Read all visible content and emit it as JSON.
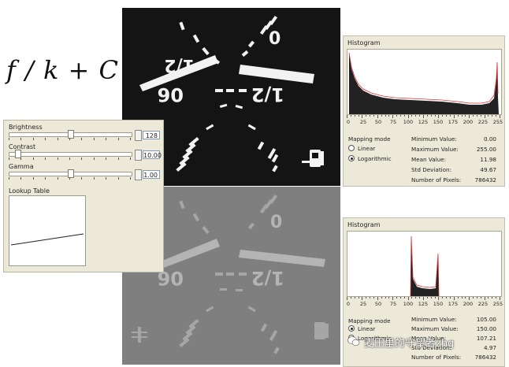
{
  "formula": "f / k + C",
  "controls": {
    "brightness": {
      "label": "Brightness",
      "value": "128",
      "level": 0.5
    },
    "contrast": {
      "label": "Contrast",
      "value": "10.00",
      "level": 0.05
    },
    "gamma": {
      "label": "Gamma",
      "value": "1.00",
      "level": 0.5
    },
    "lut_label": "Lookup Table"
  },
  "histograms": [
    {
      "title": "Histogram",
      "axis_labels": [
        "0",
        "25",
        "50",
        "75",
        "100",
        "125",
        "150",
        "175",
        "200",
        "225",
        "255"
      ],
      "mapping_mode_label": "Mapping mode",
      "linear_label": "Linear",
      "log_label": "Logarithmic",
      "selected_mode": "Logarithmic",
      "stats": [
        {
          "name": "Minimum Value:",
          "value": "0.00"
        },
        {
          "name": "Maximum Value:",
          "value": "255.00"
        },
        {
          "name": "Mean Value:",
          "value": "11.98"
        },
        {
          "name": "Std Deviation:",
          "value": "49.67"
        },
        {
          "name": "Number of Pixels:",
          "value": "786432"
        }
      ]
    },
    {
      "title": "Histogram",
      "axis_labels": [
        "0",
        "25",
        "50",
        "75",
        "100",
        "125",
        "150",
        "175",
        "200",
        "225",
        "255"
      ],
      "mapping_mode_label": "Mapping mode",
      "linear_label": "Linear",
      "log_label": "Logarithmic",
      "selected_mode": "Linear",
      "stats": [
        {
          "name": "Minimum Value:",
          "value": "105.00"
        },
        {
          "name": "Maximum Value:",
          "value": "150.00"
        },
        {
          "name": "Mean Value:",
          "value": "107.21"
        },
        {
          "name": "Std Deviation:",
          "value": "4.97"
        },
        {
          "name": "Number of Pixels:",
          "value": "786432"
        }
      ]
    }
  ],
  "gauge_text": {
    "zero": "0",
    "half": "1/2",
    "tick_label": "06"
  },
  "watermark": "麦田里的守望者zhg",
  "colors": {
    "dialog_bg": "#ece9d8",
    "hist_red": "#e03030",
    "dark_image": "#141414",
    "gray_image": "#7f7f7f"
  }
}
